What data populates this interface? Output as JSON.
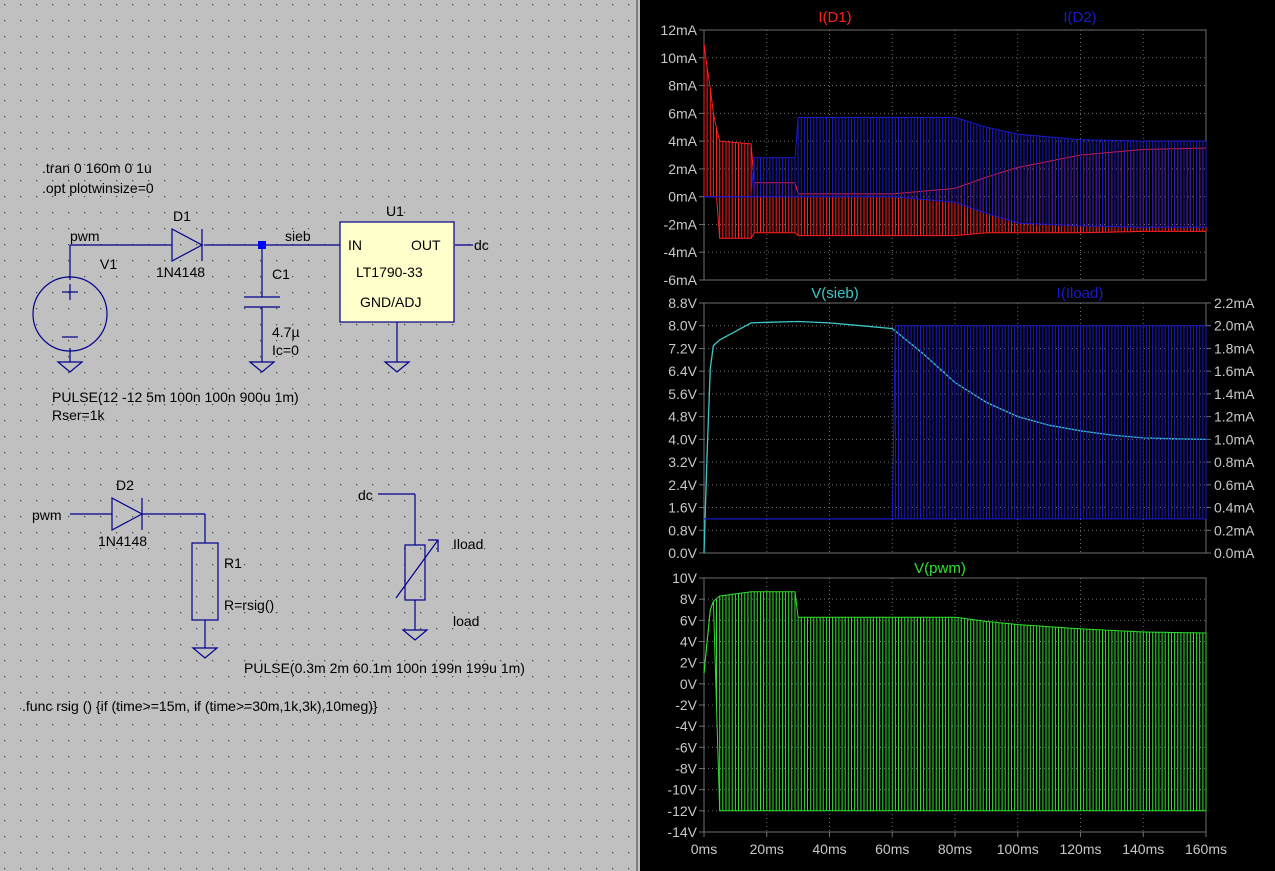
{
  "schematic": {
    "directives": [
      ".tran 0 160m 0 1u",
      ".opt plotwinsize=0"
    ],
    "func_directive": ".func rsig () {if (time>=15m, if (time>=30m,1k,3k),10meg)}",
    "components": {
      "d1": {
        "name": "D1",
        "model": "1N4148"
      },
      "d2": {
        "name": "D2",
        "model": "1N4148"
      },
      "v1": {
        "name": "V1",
        "value": "PULSE(12 -12 5m 100n 100n 900u 1m)",
        "rser": "Rser=1k"
      },
      "c1": {
        "name": "C1",
        "value": "4.7µ",
        "ic": "Ic=0"
      },
      "u1": {
        "name": "U1",
        "part": "LT1790-33",
        "pin_in": "IN",
        "pin_out": "OUT",
        "pin_gnd": "GND/ADJ"
      },
      "r1": {
        "name": "R1",
        "value": "R=rsig()"
      },
      "iload": {
        "name": "Iload",
        "label": "load",
        "value": "PULSE(0.3m 2m 60.1m 100n 199n 199u 1m)"
      }
    },
    "nets": {
      "pwm_top": "pwm",
      "pwm_bottom": "pwm",
      "sieb": "sieb",
      "dc_out": "dc",
      "dc_load": "dc"
    }
  },
  "waveforms": {
    "x_ticks": [
      "0ms",
      "20ms",
      "40ms",
      "60ms",
      "80ms",
      "100ms",
      "120ms",
      "140ms",
      "160ms"
    ],
    "colors": {
      "red": "#ff2020",
      "blue": "#1a1acd",
      "cyan": "#3cc8c8",
      "green": "#30e030",
      "grid": "#6e6e6e",
      "axis_text": "#c8c8c8"
    }
  },
  "chart_data": [
    {
      "type": "line",
      "title": "",
      "xlabel": "",
      "ylabel": "",
      "x_unit": "ms",
      "xlim": [
        0,
        160
      ],
      "ylim": [
        -6,
        12
      ],
      "y_unit": "mA",
      "y_ticks": [
        "12mA",
        "10mA",
        "8mA",
        "6mA",
        "4mA",
        "2mA",
        "0mA",
        "-2mA",
        "-4mA",
        "-6mA"
      ],
      "grid": true,
      "series": [
        {
          "name": "I(D1)",
          "color": "#ff2020",
          "render": "envelope",
          "x": [
            0,
            1,
            2,
            3,
            4,
            5,
            15,
            15.1,
            29.9,
            30,
            60,
            65,
            80,
            90,
            100,
            120,
            140,
            160
          ],
          "upper": [
            11,
            9.3,
            7.8,
            6.0,
            4.9,
            4.0,
            3.8,
            1.0,
            1.0,
            0.2,
            0.2,
            0.3,
            0.6,
            1.4,
            2.1,
            3.0,
            3.4,
            3.5
          ],
          "lower": [
            0,
            0,
            0,
            0,
            0,
            -3.0,
            -3.0,
            -2.6,
            -2.6,
            -2.8,
            -2.8,
            -2.8,
            -2.8,
            -2.6,
            -2.6,
            -2.6,
            -2.5,
            -2.5
          ]
        },
        {
          "name": "I(D2)",
          "color": "#1a1acd",
          "render": "envelope",
          "x": [
            0,
            5,
            15,
            15.1,
            29.9,
            30,
            60,
            80,
            90,
            100,
            120,
            140,
            160
          ],
          "upper": [
            0,
            0,
            0,
            2.8,
            2.8,
            5.7,
            5.7,
            5.7,
            5.0,
            4.5,
            4.1,
            4.0,
            4.0
          ],
          "lower": [
            0,
            0,
            0,
            0,
            0,
            0,
            0,
            -0.4,
            -1.2,
            -1.9,
            -2.1,
            -2.2,
            -2.2
          ]
        }
      ]
    },
    {
      "type": "line",
      "title": "",
      "xlabel": "",
      "ylabel": "",
      "x_unit": "ms",
      "xlim": [
        0,
        160
      ],
      "ylim": [
        0,
        8.8
      ],
      "y_unit": "V",
      "y_ticks": [
        "8.8V",
        "8.0V",
        "7.2V",
        "6.4V",
        "5.6V",
        "4.8V",
        "4.0V",
        "3.2V",
        "2.4V",
        "1.6V",
        "0.8V",
        "0.0V"
      ],
      "y2lim": [
        0,
        2.2
      ],
      "y2_unit": "mA",
      "y2_ticks": [
        "2.2mA",
        "2.0mA",
        "1.8mA",
        "1.6mA",
        "1.4mA",
        "1.2mA",
        "1.0mA",
        "0.8mA",
        "0.6mA",
        "0.4mA",
        "0.2mA",
        "0.0mA"
      ],
      "grid": true,
      "series": [
        {
          "name": "V(sieb)",
          "color": "#3cc8c8",
          "axis": "left",
          "x": [
            0,
            1,
            2,
            3,
            5,
            10,
            15,
            20,
            30,
            40,
            50,
            60,
            70,
            80,
            90,
            100,
            110,
            120,
            130,
            140,
            150,
            160
          ],
          "y": [
            0,
            3.5,
            6.5,
            7.3,
            7.5,
            7.8,
            8.1,
            8.12,
            8.15,
            8.1,
            8.0,
            7.9,
            7.0,
            6.0,
            5.3,
            4.8,
            4.5,
            4.3,
            4.15,
            4.05,
            4.02,
            4.0
          ]
        },
        {
          "name": "I(Iload)",
          "color": "#1a1acd",
          "axis": "right",
          "render": "envelope",
          "x": [
            0,
            60,
            60.1,
            160
          ],
          "upper": [
            0.3,
            0.3,
            2.0,
            2.0
          ],
          "lower": [
            0.3,
            0.3,
            0.3,
            0.3
          ]
        }
      ]
    },
    {
      "type": "line",
      "title": "",
      "xlabel": "",
      "ylabel": "",
      "x_unit": "ms",
      "xlim": [
        0,
        160
      ],
      "ylim": [
        -14,
        10
      ],
      "y_unit": "V",
      "y_ticks": [
        "10V",
        "8V",
        "6V",
        "4V",
        "2V",
        "0V",
        "-2V",
        "-4V",
        "-6V",
        "-8V",
        "-10V",
        "-12V",
        "-14V"
      ],
      "grid": true,
      "series": [
        {
          "name": "V(pwm)",
          "color": "#30e030",
          "render": "envelope",
          "x": [
            0,
            1,
            2,
            3,
            5,
            15,
            29.9,
            30,
            60,
            80,
            90,
            100,
            120,
            140,
            160
          ],
          "upper": [
            1.0,
            4.0,
            7.0,
            7.8,
            8.3,
            8.7,
            8.7,
            6.3,
            6.3,
            6.3,
            5.9,
            5.6,
            5.2,
            4.9,
            4.8
          ],
          "lower": [
            1.0,
            4.0,
            7.0,
            7.8,
            -12,
            -12,
            -12,
            -12,
            -12,
            -12,
            -12,
            -12,
            -12,
            -12,
            -12
          ]
        }
      ]
    }
  ]
}
